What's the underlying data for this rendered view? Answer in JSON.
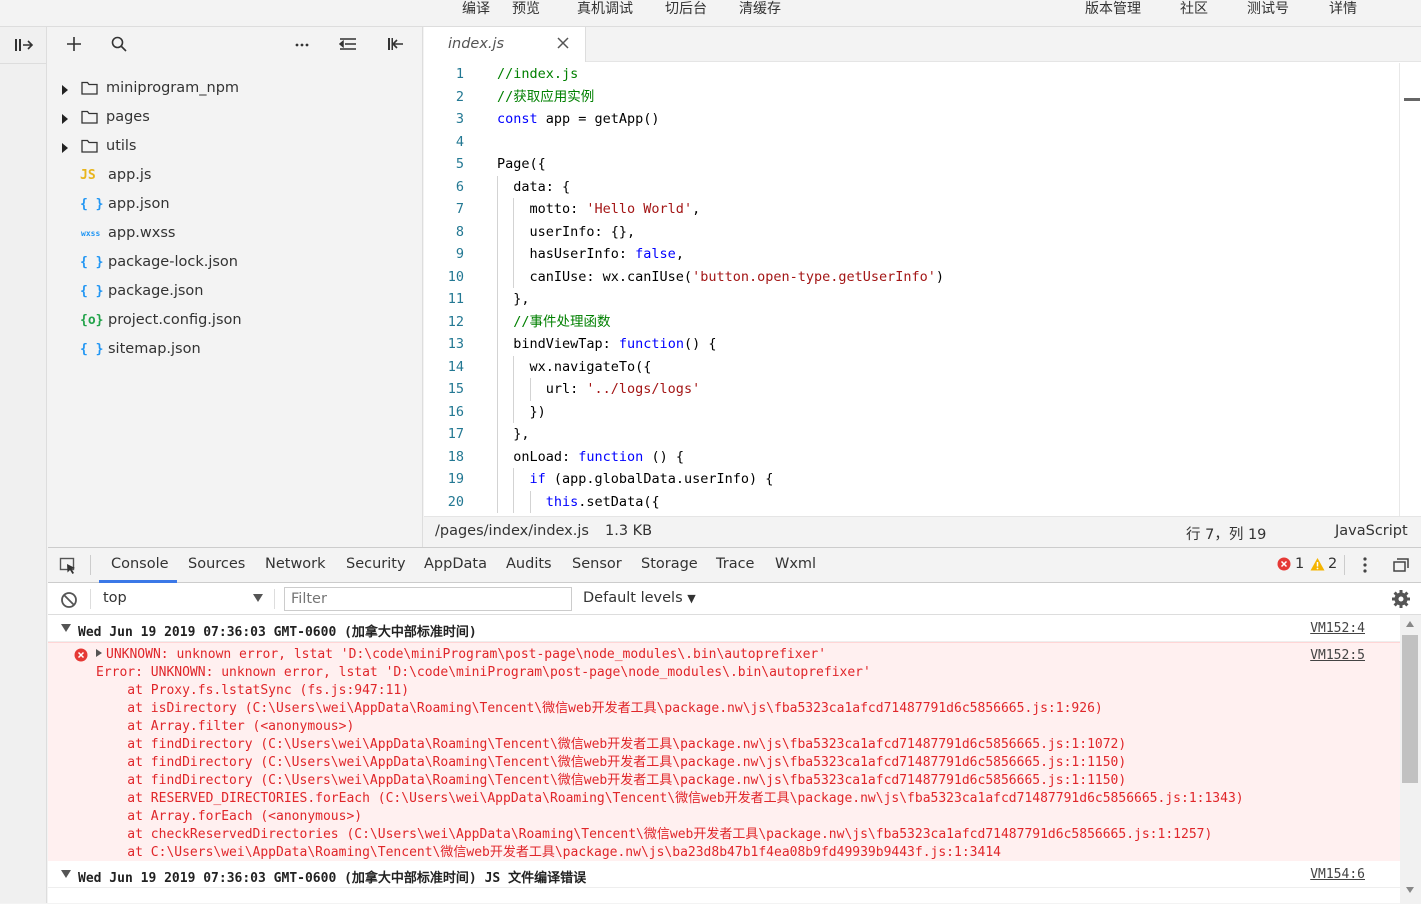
{
  "topbar": {
    "left_items": [
      "编译",
      "预览",
      "真机调试",
      "切后台",
      "清缓存"
    ],
    "right_items": [
      "版本管理",
      "社区",
      "测试号",
      "详情"
    ]
  },
  "explorer": {
    "tree": [
      {
        "type": "folder",
        "label": "miniprogram_npm",
        "icon": "folder-icon"
      },
      {
        "type": "folder",
        "label": "pages",
        "icon": "folder-icon"
      },
      {
        "type": "folder",
        "label": "utils",
        "icon": "folder-icon"
      },
      {
        "type": "file",
        "label": "app.js",
        "icon_text": "JS",
        "icon": "js-file-icon",
        "icon_color": "#e8b51c"
      },
      {
        "type": "file",
        "label": "app.json",
        "icon_text": "{ }",
        "icon": "json-file-icon",
        "icon_color": "#2196f3"
      },
      {
        "type": "file",
        "label": "app.wxss",
        "icon_text": "wxss",
        "icon": "wxss-file-icon",
        "icon_color": "#2196f3"
      },
      {
        "type": "file",
        "label": "package-lock.json",
        "icon_text": "{ }",
        "icon": "json-file-icon",
        "icon_color": "#2196f3"
      },
      {
        "type": "file",
        "label": "package.json",
        "icon_text": "{ }",
        "icon": "json-file-icon",
        "icon_color": "#2196f3"
      },
      {
        "type": "file",
        "label": "project.config.json",
        "icon_text": "{o}",
        "icon": "config-file-icon",
        "icon_color": "#22a34a"
      },
      {
        "type": "file",
        "label": "sitemap.json",
        "icon_text": "{ }",
        "icon": "json-file-icon",
        "icon_color": "#2196f3"
      }
    ]
  },
  "editor": {
    "tab_label": "index.js",
    "code_lines": [
      "//index.js",
      "//获取应用实例",
      "const app = getApp()",
      "",
      "Page({",
      "  data: {",
      "    motto: 'Hello World',",
      "    userInfo: {},",
      "    hasUserInfo: false,",
      "    canIUse: wx.canIUse('button.open-type.getUserInfo')",
      "  },",
      "  //事件处理函数",
      "  bindViewTap: function() {",
      "    wx.navigateTo({",
      "      url: '../logs/logs'",
      "    })",
      "  },",
      "  onLoad: function () {",
      "    if (app.globalData.userInfo) {",
      "      this.setData({"
    ],
    "status": {
      "path": "/pages/index/index.js",
      "size": "1.3 KB",
      "position": "行 7，列 19",
      "language": "JavaScript"
    }
  },
  "devtools": {
    "tabs": [
      "Console",
      "Sources",
      "Network",
      "Security",
      "AppData",
      "Audits",
      "Sensor",
      "Storage",
      "Trace",
      "Wxml"
    ],
    "active_tab": "Console",
    "error_count": "1",
    "warning_count": "2",
    "context": "top",
    "filter_placeholder": "Filter",
    "levels": "Default levels",
    "groups": [
      {
        "text": "Wed Jun 19 2019 07:36:03 GMT-0600 (加拿大中部标准时间)",
        "source": "VM152:4"
      },
      {
        "text": "Wed Jun 19 2019 07:36:03 GMT-0600 (加拿大中部标准时间) JS 文件编译错误",
        "source": "VM154:6"
      }
    ],
    "error": {
      "source": "VM152:5",
      "lines": [
        "UNKNOWN: unknown error, lstat 'D:\\code\\miniProgram\\post-page\\node_modules\\.bin\\autoprefixer'",
        "Error: UNKNOWN: unknown error, lstat 'D:\\code\\miniProgram\\post-page\\node_modules\\.bin\\autoprefixer'",
        "    at Proxy.fs.lstatSync (fs.js:947:11)",
        "    at isDirectory (C:\\Users\\wei\\AppData\\Roaming\\Tencent\\微信web开发者工具\\package.nw\\js\\fba5323ca1afcd71487791d6c5856665.js:1:926)",
        "    at Array.filter (<anonymous>)",
        "    at findDirectory (C:\\Users\\wei\\AppData\\Roaming\\Tencent\\微信web开发者工具\\package.nw\\js\\fba5323ca1afcd71487791d6c5856665.js:1:1072)",
        "    at findDirectory (C:\\Users\\wei\\AppData\\Roaming\\Tencent\\微信web开发者工具\\package.nw\\js\\fba5323ca1afcd71487791d6c5856665.js:1:1150)",
        "    at findDirectory (C:\\Users\\wei\\AppData\\Roaming\\Tencent\\微信web开发者工具\\package.nw\\js\\fba5323ca1afcd71487791d6c5856665.js:1:1150)",
        "    at RESERVED_DIRECTORIES.forEach (C:\\Users\\wei\\AppData\\Roaming\\Tencent\\微信web开发者工具\\package.nw\\js\\fba5323ca1afcd71487791d6c5856665.js:1:1343)",
        "    at Array.forEach (<anonymous>)",
        "    at checkReservedDirectories (C:\\Users\\wei\\AppData\\Roaming\\Tencent\\微信web开发者工具\\package.nw\\js\\fba5323ca1afcd71487791d6c5856665.js:1:1257)",
        "    at C:\\Users\\wei\\AppData\\Roaming\\Tencent\\微信web开发者工具\\package.nw\\js\\ba23d8b47b1f4ea08b9fd49939b9443f.js:1:3414"
      ]
    }
  }
}
